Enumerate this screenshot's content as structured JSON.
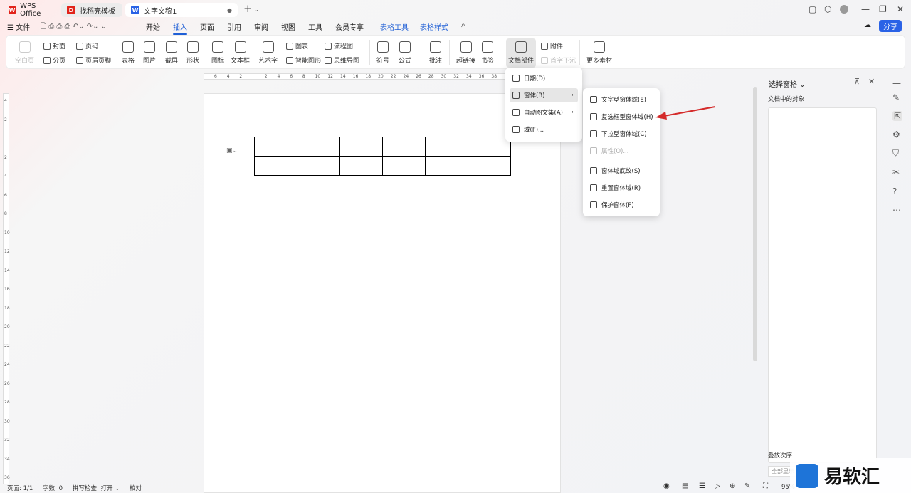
{
  "tabs": [
    {
      "label": "WPS Office",
      "icon": "wps-logo"
    },
    {
      "label": "找稻壳模板",
      "icon": "docer-icon"
    },
    {
      "label": "文字文稿1",
      "icon": "word-doc-icon"
    }
  ],
  "menu": [
    "文件",
    "开始",
    "插入",
    "页面",
    "引用",
    "审阅",
    "视图",
    "工具",
    "会员专享",
    "表格工具",
    "表格样式"
  ],
  "share": "分享",
  "ribbon": {
    "blank_page": "空白页",
    "cover": "封面",
    "page_num": "页码",
    "page_break": "分页",
    "header_footer": "页眉页脚",
    "table": "表格",
    "picture": "图片",
    "screenshot": "截屏",
    "shape": "形状",
    "icon": "图标",
    "textbox": "文本框",
    "wordart": "艺术字",
    "chart": "图表",
    "smartart": "智能图形",
    "flowchart": "流程图",
    "mindmap": "思维导图",
    "symbol": "符号",
    "formula": "公式",
    "comment": "批注",
    "hyperlink": "超链接",
    "bookmark": "书签",
    "docparts": "文档部件",
    "attachment": "附件",
    "dropcap": "首字下沉",
    "more": "更多素材"
  },
  "ruler_top": [
    "6",
    "4",
    "2",
    "",
    "2",
    "4",
    "6",
    "8",
    "10",
    "12",
    "14",
    "16",
    "18",
    "20",
    "22",
    "24",
    "26",
    "28",
    "30",
    "32",
    "34",
    "36",
    "38"
  ],
  "ruler_left": [
    "4",
    "2",
    "",
    "2",
    "4",
    "6",
    "8",
    "10",
    "12",
    "14",
    "16",
    "18",
    "20",
    "22",
    "24",
    "26",
    "28",
    "30",
    "32",
    "34",
    "36"
  ],
  "menu_docparts": [
    {
      "label": "日期(D)"
    },
    {
      "label": "窗体(B)"
    },
    {
      "label": "自动图文集(A)"
    },
    {
      "label": "域(F)..."
    }
  ],
  "menu_form": [
    {
      "label": "文字型窗体域(E)"
    },
    {
      "label": "复选框型窗体域(H)"
    },
    {
      "label": "下拉型窗体域(C)"
    },
    {
      "label": "属性(O)..."
    },
    {
      "label": "窗体域底纹(S)"
    },
    {
      "label": "重置窗体域(R)"
    },
    {
      "label": "保护窗体(F)"
    }
  ],
  "pane": {
    "title": "选择窗格",
    "subtitle": "文档中的对象",
    "order": "叠放次序",
    "show_all": "全部显示"
  },
  "status": {
    "page": "页面: 1/1",
    "words": "字数: 0",
    "spell": "拼写检查: 打开",
    "proof": "校对",
    "zoom": "95%"
  },
  "watermark": "易软汇",
  "colors": {
    "accent": "#1f5fd6",
    "arrow": "#d42a2a"
  }
}
